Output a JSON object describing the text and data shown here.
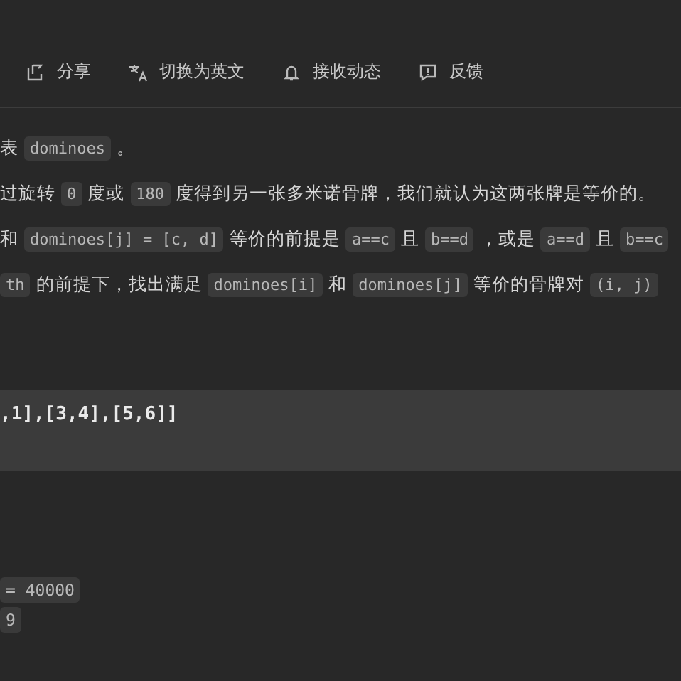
{
  "toolbar": [
    {
      "kind": "share",
      "label": "分享"
    },
    {
      "kind": "translate",
      "label": "切换为英文"
    },
    {
      "kind": "bell",
      "label": "接收动态"
    },
    {
      "kind": "feedback",
      "label": "反馈"
    }
  ],
  "paragraphs": [
    [
      {
        "kind": "text",
        "text": "表"
      },
      {
        "kind": "code",
        "text": "dominoes"
      },
      {
        "kind": "text",
        "text": "。"
      }
    ],
    [
      {
        "kind": "text",
        "text": "过旋转"
      },
      {
        "kind": "code",
        "text": "0"
      },
      {
        "kind": "text",
        "text": "度或"
      },
      {
        "kind": "code",
        "text": "180"
      },
      {
        "kind": "text",
        "text": "度得到另一张多米诺骨牌，我们就认为这两张牌是等价的。"
      }
    ],
    [
      {
        "kind": "text",
        "text": "和"
      },
      {
        "kind": "code",
        "text": "dominoes[j] = [c, d]"
      },
      {
        "kind": "text",
        "text": "等价的前提是"
      },
      {
        "kind": "code",
        "text": "a==c"
      },
      {
        "kind": "text",
        "text": "且"
      },
      {
        "kind": "code",
        "text": "b==d"
      },
      {
        "kind": "text",
        "text": "，或是"
      },
      {
        "kind": "code",
        "text": "a==d"
      },
      {
        "kind": "text",
        "text": "且"
      },
      {
        "kind": "code",
        "text": "b==c"
      }
    ],
    [
      {
        "kind": "code",
        "text": "th"
      },
      {
        "kind": "text",
        "text": "的前提下，找出满足"
      },
      {
        "kind": "code",
        "text": "dominoes[i]"
      },
      {
        "kind": "text",
        "text": "和"
      },
      {
        "kind": "code",
        "text": "dominoes[j]"
      },
      {
        "kind": "text",
        "text": "等价的骨牌对"
      },
      {
        "kind": "code",
        "text": "(i, j)"
      }
    ]
  ],
  "code_block": ",1],[3,4],[5,6]]",
  "constraints": [
    "= 40000",
    "9"
  ]
}
